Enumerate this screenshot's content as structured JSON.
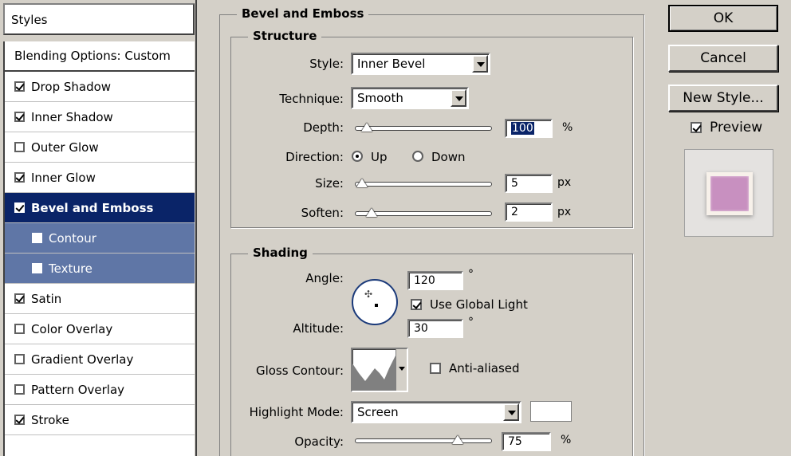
{
  "styles_panel": {
    "header": "Styles",
    "items": [
      {
        "label": "Blending Options: Custom",
        "type": "blend"
      },
      {
        "label": "Drop Shadow",
        "checked": true
      },
      {
        "label": "Inner Shadow",
        "checked": true
      },
      {
        "label": "Outer Glow",
        "checked": false
      },
      {
        "label": "Inner Glow",
        "checked": true
      },
      {
        "label": "Bevel and Emboss",
        "checked": true,
        "selected": true
      },
      {
        "label": "Contour",
        "checked": false,
        "sub": true
      },
      {
        "label": "Texture",
        "checked": false,
        "sub": true
      },
      {
        "label": "Satin",
        "checked": true
      },
      {
        "label": "Color Overlay",
        "checked": false
      },
      {
        "label": "Gradient Overlay",
        "checked": false
      },
      {
        "label": "Pattern Overlay",
        "checked": false
      },
      {
        "label": "Stroke",
        "checked": true
      }
    ]
  },
  "bevel": {
    "title": "Bevel and Emboss",
    "structure": {
      "title": "Structure",
      "style_label": "Style:",
      "style_value": "Inner Bevel",
      "technique_label": "Technique:",
      "technique_value": "Smooth",
      "depth_label": "Depth:",
      "depth_value": "100",
      "depth_unit": "%",
      "direction_label": "Direction:",
      "direction_up": "Up",
      "direction_down": "Down",
      "direction_selected": "Up",
      "size_label": "Size:",
      "size_value": "5",
      "size_unit": "px",
      "soften_label": "Soften:",
      "soften_value": "2",
      "soften_unit": "px"
    },
    "shading": {
      "title": "Shading",
      "angle_label": "Angle:",
      "angle_value": "120",
      "degree": "°",
      "use_global_light": "Use Global Light",
      "use_global_light_checked": true,
      "altitude_label": "Altitude:",
      "altitude_value": "30",
      "gloss_contour_label": "Gloss Contour:",
      "anti_aliased": "Anti-aliased",
      "anti_aliased_checked": false,
      "highlight_mode_label": "Highlight Mode:",
      "highlight_mode_value": "Screen",
      "highlight_color": "#ffffff",
      "opacity_label": "Opacity:",
      "opacity_value": "75",
      "opacity_unit": "%"
    }
  },
  "buttons": {
    "ok": "OK",
    "cancel": "Cancel",
    "new_style": "New Style...",
    "preview": "Preview",
    "preview_checked": true
  },
  "colors": {
    "selected_bg": "#0a2468",
    "sub_bg": "#5f76a6",
    "preview_fill": "#c890c0"
  }
}
